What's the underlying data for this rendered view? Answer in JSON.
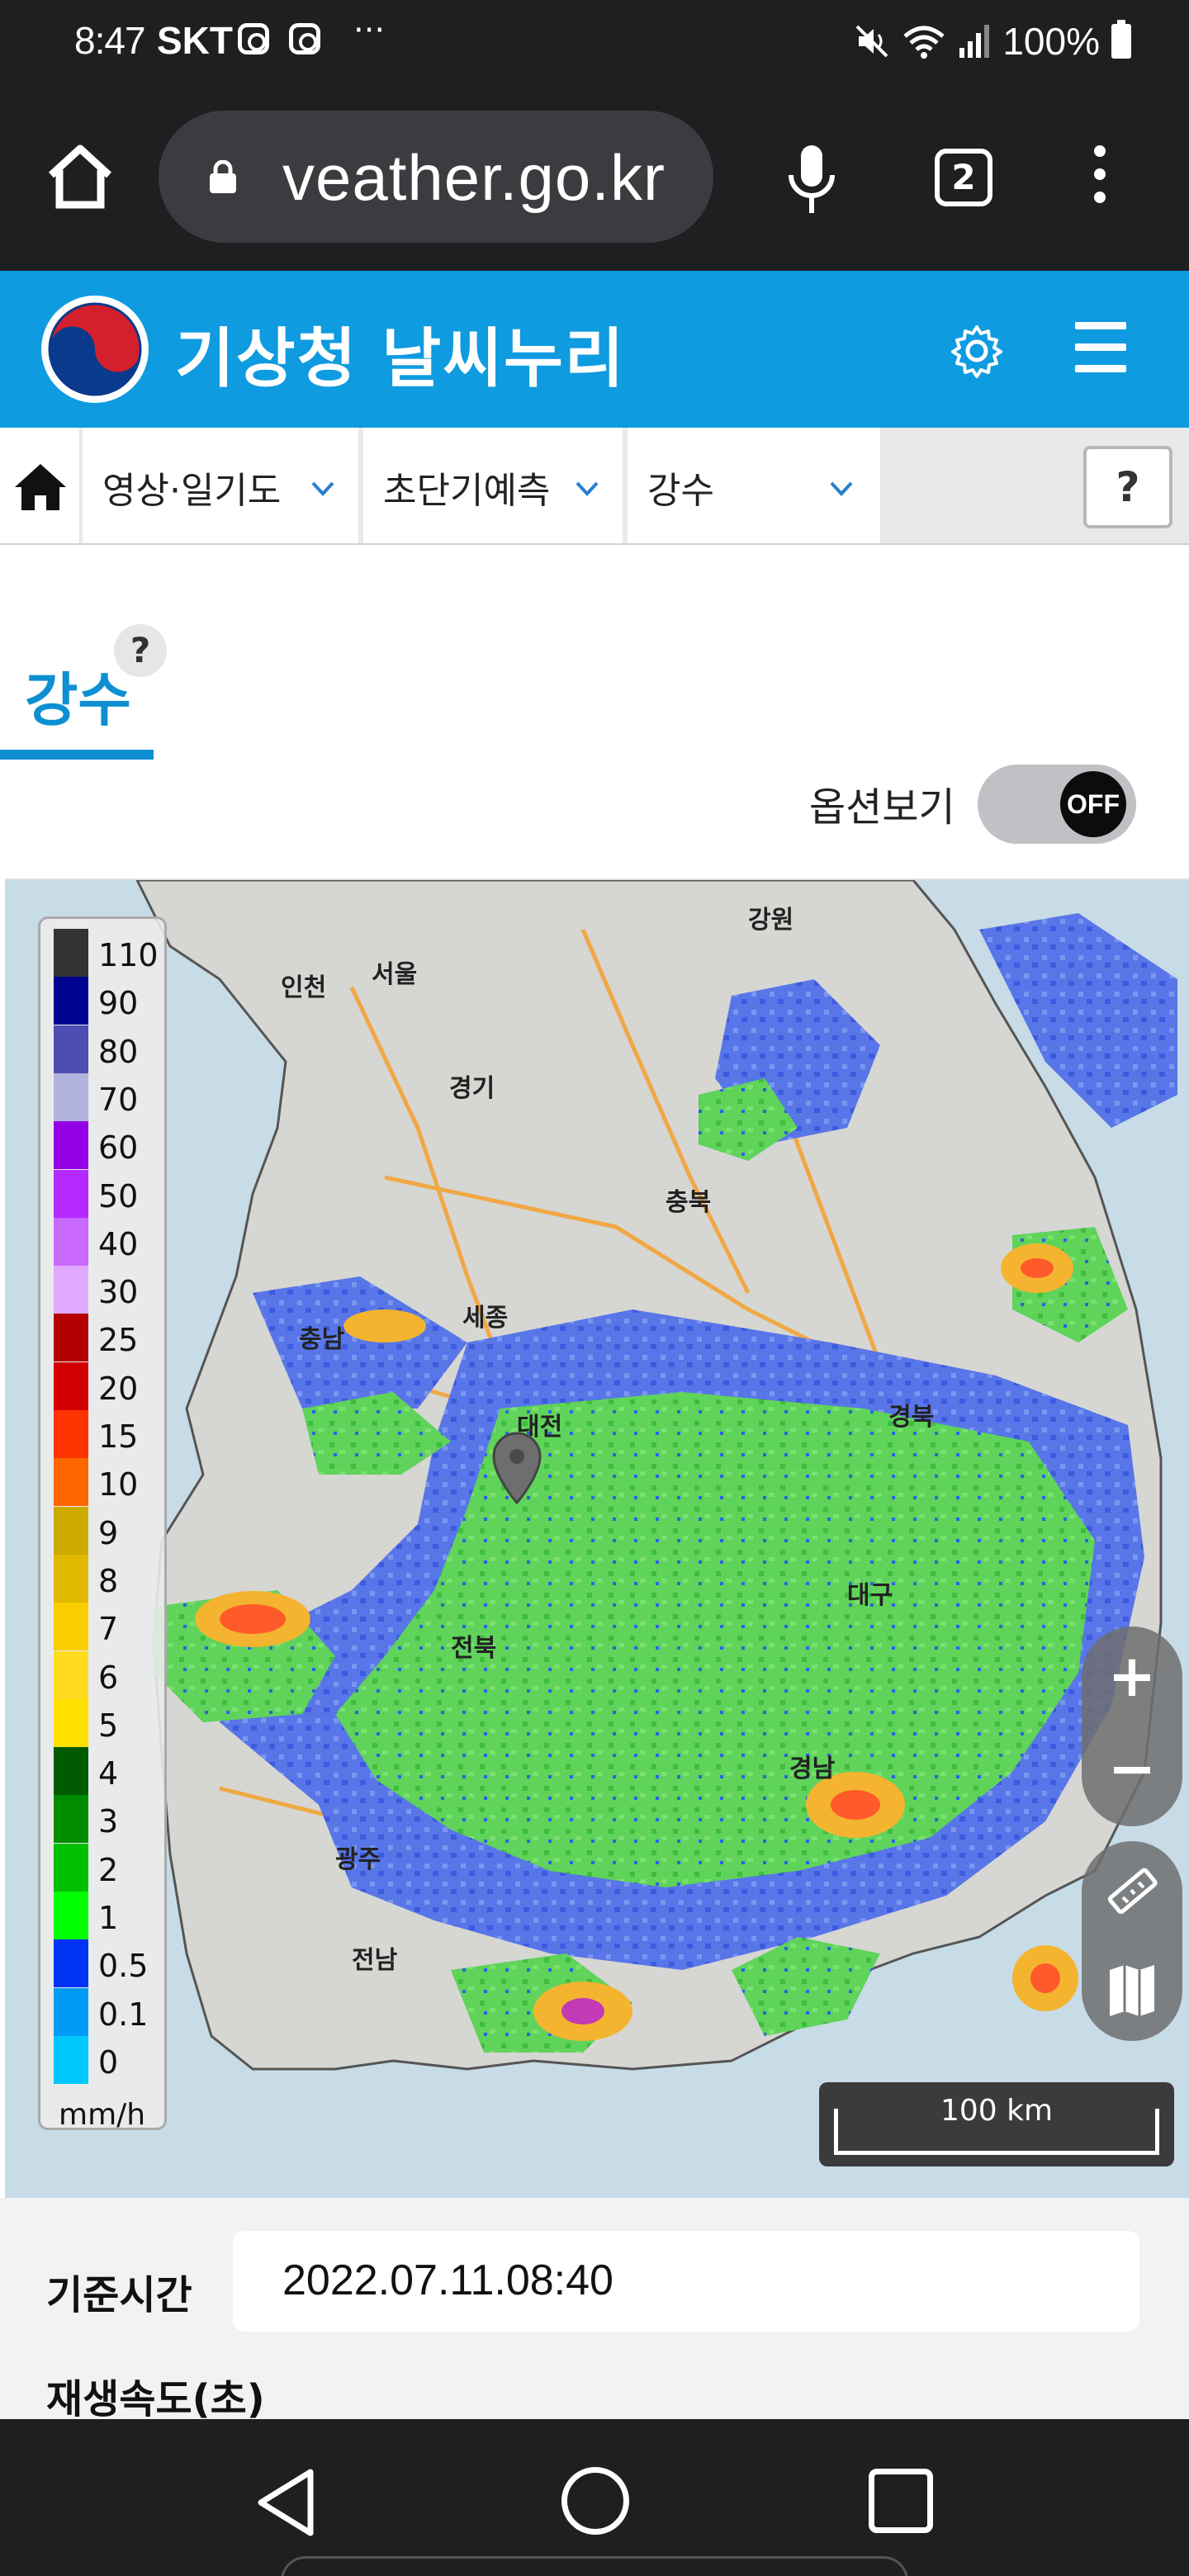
{
  "status_bar": {
    "time": "8:47",
    "carrier": "SKT",
    "more": "···",
    "battery_pct": "100%",
    "icons": [
      "instagram-icon",
      "instagram-icon",
      "mute-icon",
      "wifi-icon",
      "signal-icon",
      "battery-icon"
    ]
  },
  "browser": {
    "url": "weather.go.kr",
    "url_visible": "veather.go.kr",
    "tab_count": "2"
  },
  "site": {
    "title": "기상청 날씨누리",
    "brand_color": "#0e9be0"
  },
  "nav": {
    "items": [
      {
        "label": "영상·일기도"
      },
      {
        "label": "초단기예측"
      },
      {
        "label": "강수"
      }
    ],
    "help": "?"
  },
  "section": {
    "title": "강수",
    "help": "?",
    "option_label": "옵션보기",
    "option_state": "OFF"
  },
  "map": {
    "place_labels": [
      "인천",
      "서울",
      "경기",
      "강원",
      "충북",
      "충남",
      "세종",
      "대전",
      "경북",
      "대구",
      "전북",
      "경남",
      "광주",
      "전남"
    ],
    "legend": {
      "unit": "mm/h",
      "levels": [
        {
          "label": "110",
          "color": "#333333"
        },
        {
          "label": "90",
          "color": "#000390"
        },
        {
          "label": "80",
          "color": "#4c4eb1"
        },
        {
          "label": "70",
          "color": "#b3b4de"
        },
        {
          "label": "60",
          "color": "#9300e4"
        },
        {
          "label": "50",
          "color": "#b329ff"
        },
        {
          "label": "40",
          "color": "#c969ff"
        },
        {
          "label": "30",
          "color": "#e0a9ff"
        },
        {
          "label": "25",
          "color": "#b40000"
        },
        {
          "label": "20",
          "color": "#d20000"
        },
        {
          "label": "15",
          "color": "#ff3300"
        },
        {
          "label": "10",
          "color": "#ff6600"
        },
        {
          "label": "9",
          "color": "#ccaa00"
        },
        {
          "label": "8",
          "color": "#e0b900"
        },
        {
          "label": "7",
          "color": "#f9cd00"
        },
        {
          "label": "6",
          "color": "#ffdc1f"
        },
        {
          "label": "5",
          "color": "#ffe100"
        },
        {
          "label": "4",
          "color": "#005a00"
        },
        {
          "label": "3",
          "color": "#008c00"
        },
        {
          "label": "2",
          "color": "#00be00"
        },
        {
          "label": "1",
          "color": "#00ff00"
        },
        {
          "label": "0.5",
          "color": "#0033f5"
        },
        {
          "label": "0.1",
          "color": "#009bf5"
        },
        {
          "label": "0",
          "color": "#00c8ff"
        }
      ]
    },
    "scale_label": "100 km",
    "zoom_in": "+",
    "zoom_out": "−"
  },
  "info": {
    "time_label": "기준시간",
    "time_value": "2022.07.11.08:40",
    "speed_label": "재생속도(초)"
  }
}
